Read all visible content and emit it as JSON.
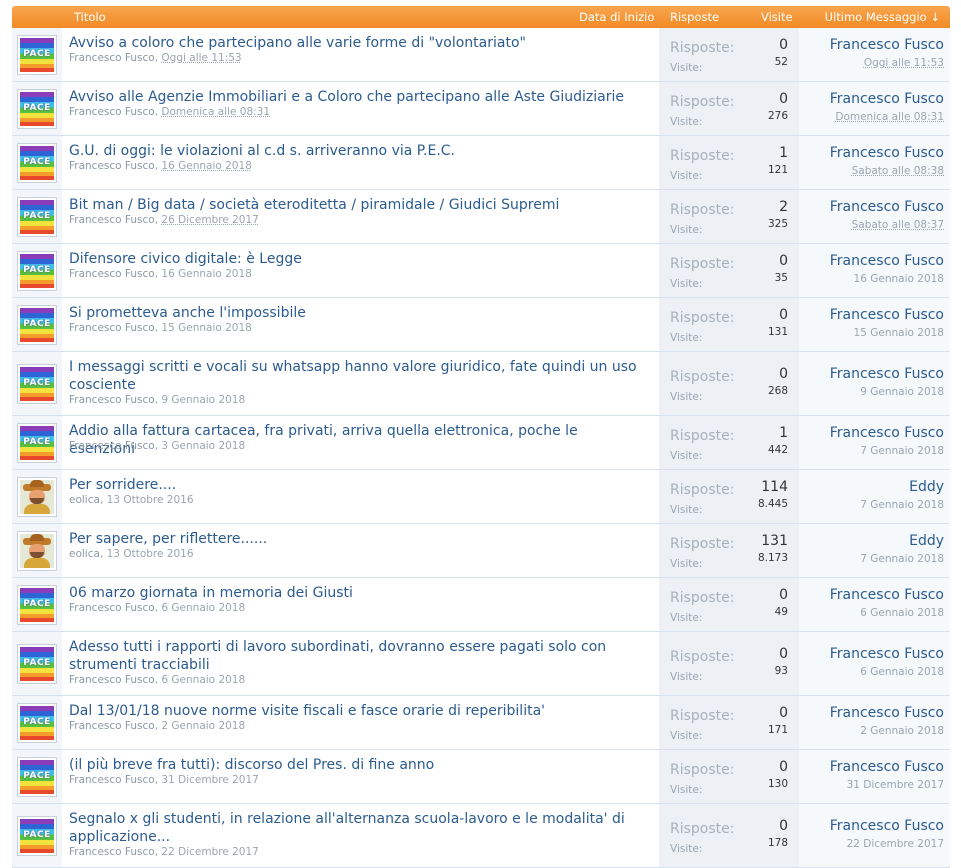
{
  "header": {
    "title_label": "Titolo",
    "date_label": "Data di Inizio",
    "replies_label": "Risposte",
    "views_label": "Visite",
    "last_label": "Ultimo Messaggio ↓"
  },
  "stats_labels": {
    "replies": "Risposte:",
    "views": "Visite:"
  },
  "threads": [
    {
      "avatar": "pace",
      "title": "Avviso a coloro che partecipano alle varie forme di \"volontariato\"",
      "author": "Francesco Fusco",
      "date": "Oggi alle 11:53",
      "replies": "0",
      "views": "52",
      "last_user": "Francesco Fusco",
      "last_date": "Oggi alle 11:53"
    },
    {
      "avatar": "pace",
      "title": "Avviso alle Agenzie Immobiliari e a Coloro che partecipano alle Aste Giudiziarie",
      "author": "Francesco Fusco",
      "date": "Domenica alle 08:31",
      "replies": "0",
      "views": "276",
      "last_user": "Francesco Fusco",
      "last_date": "Domenica alle 08:31"
    },
    {
      "avatar": "pace",
      "title": "G.U. di oggi: le violazioni al c.d s. arriveranno via P.E.C.",
      "author": "Francesco Fusco",
      "date": "16 Gennaio 2018",
      "replies": "1",
      "views": "121",
      "last_user": "Francesco Fusco",
      "last_date": "Sabato alle 08:38"
    },
    {
      "avatar": "pace",
      "title": "Bit man / Big data / società eteroditetta / piramidale / Giudici Supremi",
      "author": "Francesco Fusco",
      "date": "26 Dicembre 2017",
      "replies": "2",
      "views": "325",
      "last_user": "Francesco Fusco",
      "last_date": "Sabato alle 08:37"
    },
    {
      "avatar": "pace",
      "title": "Difensore civico digitale: è Legge",
      "author": "Francesco Fusco",
      "date": "16 Gennaio 2018",
      "replies": "0",
      "views": "35",
      "last_user": "Francesco Fusco",
      "last_date": "16 Gennaio 2018"
    },
    {
      "avatar": "pace",
      "title": "Si prometteva anche l'impossibile",
      "author": "Francesco Fusco",
      "date": "15 Gennaio 2018",
      "replies": "0",
      "views": "131",
      "last_user": "Francesco Fusco",
      "last_date": "15 Gennaio 2018"
    },
    {
      "avatar": "pace",
      "title": "I messaggi scritti e vocali su whatsapp hanno valore giuridico, fate quindi un uso cosciente",
      "author": "Francesco Fusco",
      "date": "9 Gennaio 2018",
      "replies": "0",
      "views": "268",
      "last_user": "Francesco Fusco",
      "last_date": "9 Gennaio 2018"
    },
    {
      "avatar": "pace",
      "title": "Addio alla fattura cartacea, fra privati, arriva quella elettronica, poche le esenzioni",
      "author": "Francesco Fusco",
      "date": "3 Gennaio 2018",
      "replies": "1",
      "views": "442",
      "last_user": "Francesco Fusco",
      "last_date": "7 Gennaio 2018"
    },
    {
      "avatar": "cowboy",
      "title": "Per sorridere....",
      "author": "eolica",
      "date": "13 Ottobre 2016",
      "replies": "114",
      "views": "8.445",
      "last_user": "Eddy",
      "last_date": "7 Gennaio 2018"
    },
    {
      "avatar": "cowboy",
      "title": "Per sapere, per riflettere......",
      "author": "eolica",
      "date": "13 Ottobre 2016",
      "replies": "131",
      "views": "8.173",
      "last_user": "Eddy",
      "last_date": "7 Gennaio 2018"
    },
    {
      "avatar": "pace",
      "title": "06 marzo giornata in memoria dei Giusti",
      "author": "Francesco Fusco",
      "date": "6 Gennaio 2018",
      "replies": "0",
      "views": "49",
      "last_user": "Francesco Fusco",
      "last_date": "6 Gennaio 2018"
    },
    {
      "avatar": "pace",
      "title": "Adesso tutti i rapporti di lavoro subordinati, dovranno essere pagati solo con strumenti tracciabili",
      "author": "Francesco Fusco",
      "date": "6 Gennaio 2018",
      "replies": "0",
      "views": "93",
      "last_user": "Francesco Fusco",
      "last_date": "6 Gennaio 2018"
    },
    {
      "avatar": "pace",
      "title": "Dal 13/01/18 nuove norme visite fiscali e fasce orarie di reperibilita'",
      "author": "Francesco Fusco",
      "date": "2 Gennaio 2018",
      "replies": "0",
      "views": "171",
      "last_user": "Francesco Fusco",
      "last_date": "2 Gennaio 2018"
    },
    {
      "avatar": "pace",
      "title": "(il più breve fra tutti): discorso del Pres. di fine anno",
      "author": "Francesco Fusco",
      "date": "31 Dicembre 2017",
      "replies": "0",
      "views": "130",
      "last_user": "Francesco Fusco",
      "last_date": "31 Dicembre 2017"
    },
    {
      "avatar": "pace",
      "title": "Segnalo x gli studenti, in relazione all'alternanza scuola-lavoro e le modalita' di applicazione...",
      "author": "Francesco Fusco",
      "date": "22 Dicembre 2017",
      "replies": "0",
      "views": "178",
      "last_user": "Francesco Fusco",
      "last_date": "22 Dicembre 2017"
    }
  ],
  "pace_text": "PACE"
}
